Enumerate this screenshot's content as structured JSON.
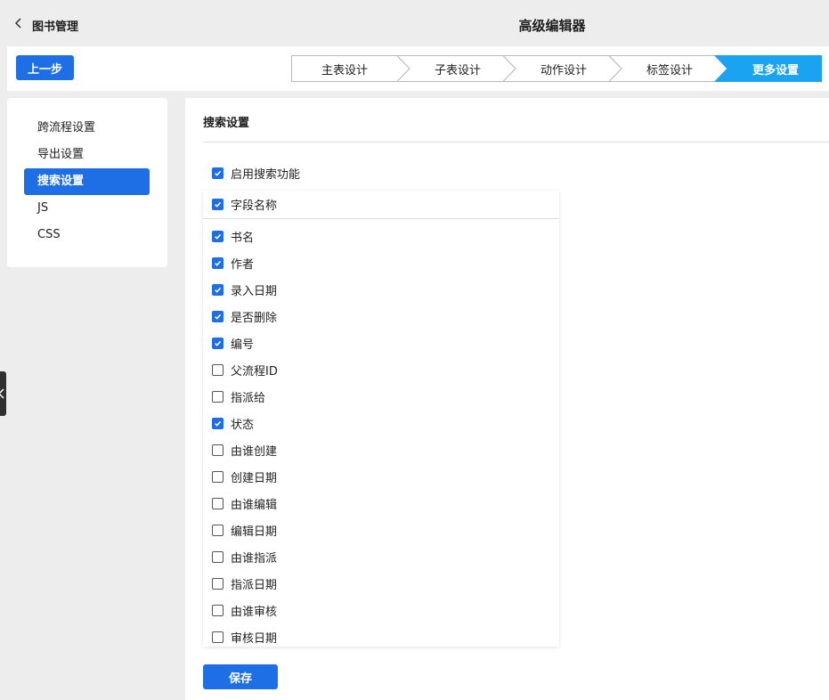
{
  "header": {
    "back_label": "图书管理",
    "title": "高级编辑器"
  },
  "stepbar": {
    "prev_label": "上一步",
    "steps": [
      {
        "label": "主表设计",
        "active": false
      },
      {
        "label": "子表设计",
        "active": false
      },
      {
        "label": "动作设计",
        "active": false
      },
      {
        "label": "标签设计",
        "active": false
      },
      {
        "label": "更多设置",
        "active": true
      }
    ]
  },
  "sidebar": {
    "items": [
      {
        "label": "跨流程设置",
        "active": false
      },
      {
        "label": "导出设置",
        "active": false
      },
      {
        "label": "搜索设置",
        "active": true
      },
      {
        "label": "JS",
        "active": false
      },
      {
        "label": "CSS",
        "active": false
      }
    ]
  },
  "search_settings": {
    "title": "搜索设置",
    "enable": {
      "label": "启用搜索功能",
      "checked": true
    },
    "field_header": {
      "label": "字段名称",
      "checked": true
    },
    "fields": [
      {
        "label": "书名",
        "checked": true
      },
      {
        "label": "作者",
        "checked": true
      },
      {
        "label": "录入日期",
        "checked": true
      },
      {
        "label": "是否删除",
        "checked": true
      },
      {
        "label": "编号",
        "checked": true
      },
      {
        "label": "父流程ID",
        "checked": false
      },
      {
        "label": "指派给",
        "checked": false
      },
      {
        "label": "状态",
        "checked": true
      },
      {
        "label": "由谁创建",
        "checked": false
      },
      {
        "label": "创建日期",
        "checked": false
      },
      {
        "label": "由谁编辑",
        "checked": false
      },
      {
        "label": "编辑日期",
        "checked": false
      },
      {
        "label": "由谁指派",
        "checked": false
      },
      {
        "label": "指派日期",
        "checked": false
      },
      {
        "label": "由谁审核",
        "checked": false
      },
      {
        "label": "审核日期",
        "checked": false
      }
    ],
    "save_label": "保存"
  },
  "colors": {
    "accent": "#1e6fe6",
    "step_active": "#1aa3f0",
    "background": "#ededed"
  }
}
